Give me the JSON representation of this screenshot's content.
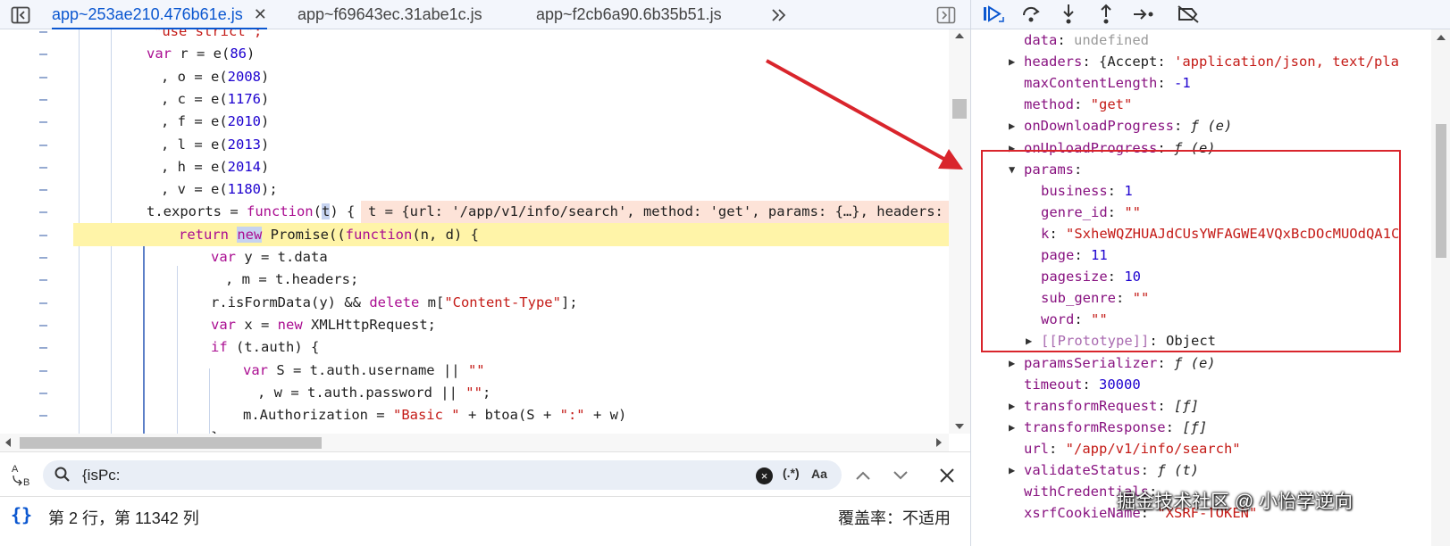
{
  "tabs": [
    {
      "label": "app~253ae210.476b61e.js",
      "active": true
    },
    {
      "label": "app~f69643ec.31abe1c.js",
      "active": false
    },
    {
      "label": "app~f2cb6a90.6b35b51.js",
      "active": false
    }
  ],
  "code": {
    "gutter_mark": "–",
    "lines": [
      {
        "segments": [
          {
            "t": "\"use strict\";",
            "c": "str"
          }
        ]
      },
      {
        "segments": [
          {
            "t": "var",
            "c": "kw"
          },
          {
            "t": " r = e(",
            "c": ""
          },
          {
            "t": "86",
            "c": "num"
          },
          {
            "t": ")",
            "c": ""
          }
        ]
      },
      {
        "segments": [
          {
            "t": ", o = e(",
            "c": ""
          },
          {
            "t": "2008",
            "c": "num"
          },
          {
            "t": ")",
            "c": ""
          }
        ]
      },
      {
        "segments": [
          {
            "t": ", c = e(",
            "c": ""
          },
          {
            "t": "1176",
            "c": "num"
          },
          {
            "t": ")",
            "c": ""
          }
        ]
      },
      {
        "segments": [
          {
            "t": ", f = e(",
            "c": ""
          },
          {
            "t": "2010",
            "c": "num"
          },
          {
            "t": ")",
            "c": ""
          }
        ]
      },
      {
        "segments": [
          {
            "t": ", l = e(",
            "c": ""
          },
          {
            "t": "2013",
            "c": "num"
          },
          {
            "t": ")",
            "c": ""
          }
        ]
      },
      {
        "segments": [
          {
            "t": ", h = e(",
            "c": ""
          },
          {
            "t": "2014",
            "c": "num"
          },
          {
            "t": ")",
            "c": ""
          }
        ]
      },
      {
        "segments": [
          {
            "t": ", v = e(",
            "c": ""
          },
          {
            "t": "1180",
            "c": "num"
          },
          {
            "t": ");",
            "c": ""
          }
        ]
      },
      {
        "segments": [
          {
            "t": "t.exports = ",
            "c": ""
          },
          {
            "t": "function",
            "c": "kw"
          },
          {
            "t": "(",
            "c": ""
          },
          {
            "t": "t",
            "c": "sel"
          },
          {
            "t": ") {",
            "c": ""
          }
        ],
        "inline_value": "t = {url: '/app/v1/info/search', method: 'get', params: {…}, headers: {"
      },
      {
        "segments": [
          {
            "t": "return",
            "c": "kw"
          },
          {
            "t": " ",
            "c": ""
          },
          {
            "t": "new",
            "c": "kw sel"
          },
          {
            "t": " Promise((",
            "c": ""
          },
          {
            "t": "function",
            "c": "kw"
          },
          {
            "t": "(n, d) {",
            "c": ""
          }
        ],
        "current": true
      },
      {
        "segments": [
          {
            "t": "var",
            "c": "kw"
          },
          {
            "t": " y = t.data",
            "c": ""
          }
        ]
      },
      {
        "segments": [
          {
            "t": ", m = t.headers;",
            "c": ""
          }
        ]
      },
      {
        "segments": [
          {
            "t": "r.isFormData(y) && ",
            "c": ""
          },
          {
            "t": "delete",
            "c": "kw"
          },
          {
            "t": " m[",
            "c": ""
          },
          {
            "t": "\"Content-Type\"",
            "c": "str"
          },
          {
            "t": "];",
            "c": ""
          }
        ]
      },
      {
        "segments": [
          {
            "t": "var",
            "c": "kw"
          },
          {
            "t": " x = ",
            "c": ""
          },
          {
            "t": "new",
            "c": "kw"
          },
          {
            "t": " XMLHttpRequest;",
            "c": ""
          }
        ]
      },
      {
        "segments": [
          {
            "t": "if",
            "c": "kw"
          },
          {
            "t": " (t.auth) {",
            "c": ""
          }
        ]
      },
      {
        "segments": [
          {
            "t": "var",
            "c": "kw"
          },
          {
            "t": " S = t.auth.username || ",
            "c": ""
          },
          {
            "t": "\"\"",
            "c": "str"
          }
        ]
      },
      {
        "segments": [
          {
            "t": ", w = t.auth.password || ",
            "c": ""
          },
          {
            "t": "\"\"",
            "c": "str"
          },
          {
            "t": ";",
            "c": ""
          }
        ]
      },
      {
        "segments": [
          {
            "t": "m.Authorization = ",
            "c": ""
          },
          {
            "t": "\"Basic \"",
            "c": "str"
          },
          {
            "t": " + btoa(S + ",
            "c": ""
          },
          {
            "t": "\":\"",
            "c": "str"
          },
          {
            "t": " + w)",
            "c": ""
          }
        ]
      },
      {
        "segments": [
          {
            "t": "}",
            "c": ""
          }
        ]
      }
    ]
  },
  "search": {
    "replace_toggle": "A B",
    "value": "{isPc:",
    "clear": "×",
    "regex_label": "(.*)",
    "case_label": "Aa",
    "prev": "⌃",
    "next": "⌄",
    "close": "✕"
  },
  "status": {
    "pretty_print": "{}",
    "cursor": "第 2 行，第 11342 列",
    "coverage": "覆盖率：不适用"
  },
  "scope": [
    {
      "key": "data",
      "sep": ": ",
      "value": "undefined",
      "vc": "pv-undef",
      "expand": ""
    },
    {
      "key": "headers",
      "sep": ": ",
      "value": "{Accept: 'application/json, text/pla",
      "vc": "pv-obj",
      "expand": "▶"
    },
    {
      "key": "maxContentLength",
      "sep": ": ",
      "value": "-1",
      "vc": "pv-num",
      "expand": ""
    },
    {
      "key": "method",
      "sep": ": ",
      "value": "\"get\"",
      "vc": "pv-str",
      "expand": ""
    },
    {
      "key": "onDownloadProgress",
      "sep": ": ",
      "value": "ƒ (e)",
      "vc": "pv-fn",
      "expand": "▶"
    },
    {
      "key": "onUploadProgress",
      "sep": ": ",
      "value": "ƒ (e)",
      "vc": "pv-fn",
      "expand": "▶"
    },
    {
      "key": "params",
      "sep": ":",
      "value": "",
      "vc": "pv-plain",
      "expand": "▼"
    },
    {
      "key": "business",
      "sep": ": ",
      "value": "1",
      "vc": "pv-num",
      "expand": "",
      "indent": 1
    },
    {
      "key": "genre_id",
      "sep": ": ",
      "value": "\"\"",
      "vc": "pv-str",
      "expand": "",
      "indent": 1
    },
    {
      "key": "k",
      "sep": ": ",
      "value": "\"SxheWQZHUAJdCUsYWFAGWE4VQxBcDOcMUOdQA1C",
      "vc": "pv-str",
      "expand": "",
      "indent": 1
    },
    {
      "key": "page",
      "sep": ": ",
      "value": "11",
      "vc": "pv-num",
      "expand": "",
      "indent": 1
    },
    {
      "key": "pagesize",
      "sep": ": ",
      "value": "10",
      "vc": "pv-num",
      "expand": "",
      "indent": 1
    },
    {
      "key": "sub_genre",
      "sep": ": ",
      "value": "\"\"",
      "vc": "pv-str",
      "expand": "",
      "indent": 1
    },
    {
      "key": "word",
      "sep": ": ",
      "value": "\"\"",
      "vc": "pv-str",
      "expand": "",
      "indent": 1
    },
    {
      "key": "[[Prototype]]",
      "sep": ": ",
      "value": "Object",
      "vc": "pv-plain",
      "expand": "▶",
      "indent": 1,
      "dim": true
    },
    {
      "key": "paramsSerializer",
      "sep": ": ",
      "value": "ƒ (e)",
      "vc": "pv-fn",
      "expand": "▶"
    },
    {
      "key": "timeout",
      "sep": ": ",
      "value": "30000",
      "vc": "pv-num",
      "expand": ""
    },
    {
      "key": "transformRequest",
      "sep": ": ",
      "value": "[ƒ]",
      "vc": "pv-fn",
      "expand": "▶"
    },
    {
      "key": "transformResponse",
      "sep": ": ",
      "value": "[ƒ]",
      "vc": "pv-fn",
      "expand": "▶"
    },
    {
      "key": "url",
      "sep": ": ",
      "value": "\"/app/v1/info/search\"",
      "vc": "pv-str",
      "expand": ""
    },
    {
      "key": "validateStatus",
      "sep": ": ",
      "value": "ƒ (t)",
      "vc": "pv-fn",
      "expand": "▶"
    },
    {
      "key": "withCredentials",
      "sep": ": ",
      "value": "",
      "vc": "pv-plain",
      "expand": ""
    },
    {
      "key": "xsrfCookieName",
      "sep": ": ",
      "value": "\"XSRF-TOKEN\"",
      "vc": "pv-str",
      "expand": ""
    }
  ],
  "watermark": "掘金技术社区 @ 小怡学逆向",
  "colors": {
    "accent": "#0b57d0",
    "annotation": "#d9252c",
    "highlight": "#fff4a8"
  }
}
